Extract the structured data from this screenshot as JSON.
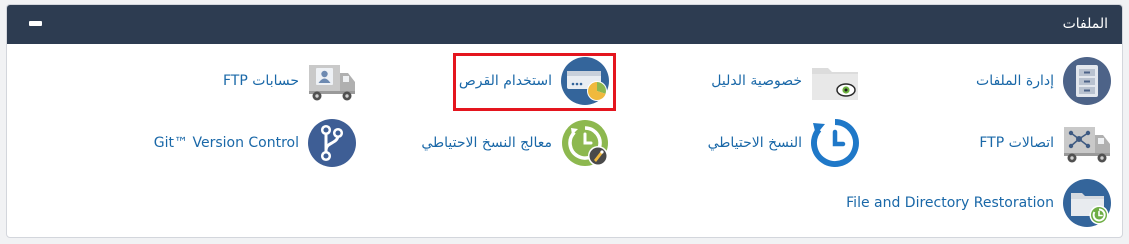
{
  "section": {
    "title": "الملفات"
  },
  "items": {
    "file_manager": "إدارة الملفات",
    "directory_privacy": "خصوصية الدليل",
    "disk_usage": "استخدام القرص",
    "ftp_accounts": "حسابات FTP",
    "ftp_connections": "اتصالات FTP",
    "backup": "النسخ الاحتياطي",
    "backup_wizard": "معالج النسخ الاحتياطي",
    "git_version_control": "Git™ Version Control",
    "file_restoration": "File and Directory Restoration"
  },
  "colors": {
    "header_bg": "#2d3c51",
    "link": "#1a68a8",
    "highlight": "#e4151e",
    "icon_blue": "#34659b",
    "icon_green": "#8db84f"
  }
}
